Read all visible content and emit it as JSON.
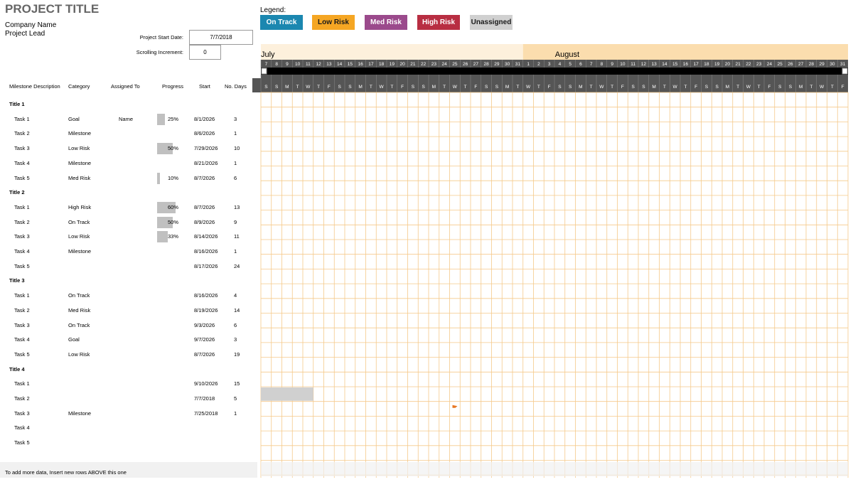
{
  "header": {
    "project_title": "PROJECT TITLE",
    "company_name": "Company Name",
    "project_lead": "Project Lead",
    "start_date_label": "Project Start Date:",
    "start_date_value": "7/7/2018",
    "scroll_label": "Scrolling Increment:",
    "scroll_value": "0"
  },
  "legend": {
    "label": "Legend:",
    "items": [
      {
        "label": "On Track",
        "color": "#1B87B0",
        "text_color": "#FFFFFF"
      },
      {
        "label": "Low Risk",
        "color": "#F5A623",
        "text_color": "#1a1a1a"
      },
      {
        "label": "Med Risk",
        "color": "#9B4A8C",
        "text_color": "#FFFFFF"
      },
      {
        "label": "High Risk",
        "color": "#B82E42",
        "text_color": "#FFFFFF"
      },
      {
        "label": "Unassigned",
        "color": "#D0D0D0",
        "text_color": "#1a1a1a"
      }
    ]
  },
  "columns": {
    "milestone": "Milestone Description",
    "category": "Category",
    "assigned": "Assigned To",
    "progress": "Progress",
    "start": "Start",
    "days": "No. Days"
  },
  "rows": [
    {
      "type": "title",
      "label": "Title 1"
    },
    {
      "type": "task",
      "label": "Task 1",
      "category": "Goal",
      "assigned": "Name",
      "progress": "25%",
      "progress_value": 0.25,
      "start": "8/1/2026",
      "days": "3"
    },
    {
      "type": "task",
      "label": "Task 2",
      "category": "Milestone",
      "assigned": "",
      "progress": "",
      "start": "8/6/2026",
      "days": "1"
    },
    {
      "type": "task",
      "label": "Task 3",
      "category": "Low Risk",
      "assigned": "",
      "progress": "50%",
      "progress_value": 0.5,
      "start": "7/29/2026",
      "days": "10"
    },
    {
      "type": "task",
      "label": "Task 4",
      "category": "Milestone",
      "assigned": "",
      "progress": "",
      "start": "8/21/2026",
      "days": "1"
    },
    {
      "type": "task",
      "label": "Task 5",
      "category": "Med Risk",
      "assigned": "",
      "progress": "10%",
      "progress_value": 0.1,
      "start": "8/7/2026",
      "days": "6"
    },
    {
      "type": "title",
      "label": "Title 2"
    },
    {
      "type": "task",
      "label": "Task 1",
      "category": "High Risk",
      "assigned": "",
      "progress": "60%",
      "progress_value": 0.6,
      "start": "8/7/2026",
      "days": "13"
    },
    {
      "type": "task",
      "label": "Task 2",
      "category": "On Track",
      "assigned": "",
      "progress": "50%",
      "progress_value": 0.5,
      "start": "8/9/2026",
      "days": "9"
    },
    {
      "type": "task",
      "label": "Task 3",
      "category": "Low Risk",
      "assigned": "",
      "progress": "33%",
      "progress_value": 0.33,
      "start": "8/14/2026",
      "days": "11"
    },
    {
      "type": "task",
      "label": "Task 4",
      "category": "Milestone",
      "assigned": "",
      "progress": "",
      "start": "8/16/2026",
      "days": "1"
    },
    {
      "type": "task",
      "label": "Task 5",
      "category": "",
      "assigned": "",
      "progress": "",
      "start": "8/17/2026",
      "days": "24"
    },
    {
      "type": "title",
      "label": "Title 3"
    },
    {
      "type": "task",
      "label": "Task 1",
      "category": "On Track",
      "assigned": "",
      "progress": "",
      "start": "8/16/2026",
      "days": "4"
    },
    {
      "type": "task",
      "label": "Task 2",
      "category": "Med Risk",
      "assigned": "",
      "progress": "",
      "start": "8/19/2026",
      "days": "14"
    },
    {
      "type": "task",
      "label": "Task 3",
      "category": "On Track",
      "assigned": "",
      "progress": "",
      "start": "9/3/2026",
      "days": "6"
    },
    {
      "type": "task",
      "label": "Task 4",
      "category": "Goal",
      "assigned": "",
      "progress": "",
      "start": "9/7/2026",
      "days": "3"
    },
    {
      "type": "task",
      "label": "Task 5",
      "category": "Low Risk",
      "assigned": "",
      "progress": "",
      "start": "8/7/2026",
      "days": "19"
    },
    {
      "type": "title",
      "label": "Title 4"
    },
    {
      "type": "task",
      "label": "Task 1",
      "category": "",
      "assigned": "",
      "progress": "",
      "start": "9/10/2026",
      "days": "15"
    },
    {
      "type": "task",
      "label": "Task 2",
      "category": "",
      "assigned": "",
      "progress": "",
      "start": "7/7/2018",
      "days": "5"
    },
    {
      "type": "task",
      "label": "Task 3",
      "category": "Milestone",
      "assigned": "",
      "progress": "",
      "start": "7/25/2018",
      "days": "1"
    },
    {
      "type": "task",
      "label": "Task 4",
      "category": "",
      "assigned": "",
      "progress": "",
      "start": "",
      "days": ""
    },
    {
      "type": "task",
      "label": "Task 5",
      "category": "",
      "assigned": "",
      "progress": "",
      "start": "",
      "days": ""
    }
  ],
  "timeline": {
    "months": [
      {
        "label": "July",
        "day_count": 25
      },
      {
        "label": "August",
        "day_count": 31
      }
    ],
    "day_numbers": [
      "7",
      "8",
      "9",
      "10",
      "11",
      "12",
      "13",
      "14",
      "15",
      "16",
      "17",
      "18",
      "19",
      "20",
      "21",
      "22",
      "23",
      "24",
      "25",
      "26",
      "27",
      "28",
      "29",
      "30",
      "31",
      "1",
      "2",
      "3",
      "4",
      "5",
      "6",
      "7",
      "8",
      "9",
      "10",
      "11",
      "12",
      "13",
      "14",
      "15",
      "16",
      "17",
      "18",
      "19",
      "20",
      "21",
      "22",
      "23",
      "24",
      "25",
      "26",
      "27",
      "28",
      "29",
      "30",
      "31"
    ],
    "weekdays": [
      "S",
      "S",
      "M",
      "T",
      "W",
      "T",
      "F",
      "S",
      "S",
      "M",
      "T",
      "W",
      "T",
      "F",
      "S",
      "S",
      "M",
      "T",
      "W",
      "T",
      "F",
      "S",
      "S",
      "M",
      "T",
      "W",
      "T",
      "F",
      "S",
      "S",
      "M",
      "T",
      "W",
      "T",
      "F",
      "S",
      "S",
      "M",
      "T",
      "W",
      "T",
      "F",
      "S",
      "S",
      "M",
      "T",
      "W",
      "T",
      "F",
      "S",
      "S",
      "M",
      "T",
      "W",
      "T",
      "F"
    ],
    "bars": [
      {
        "row_index": 20,
        "start_day_index": 0,
        "length_days": 5,
        "color": "#D0D0D0"
      }
    ],
    "milestones": [
      {
        "row_index": 21,
        "day_index": 18,
        "color": "#E87722"
      }
    ],
    "grid_color": "#F5C98A",
    "header_color": "#555555",
    "month_band_color": "#FDF0DC",
    "month_band_active_color": "#FBDDAE"
  },
  "footer": {
    "note": "To add more data, Insert new rows ABOVE this one"
  }
}
